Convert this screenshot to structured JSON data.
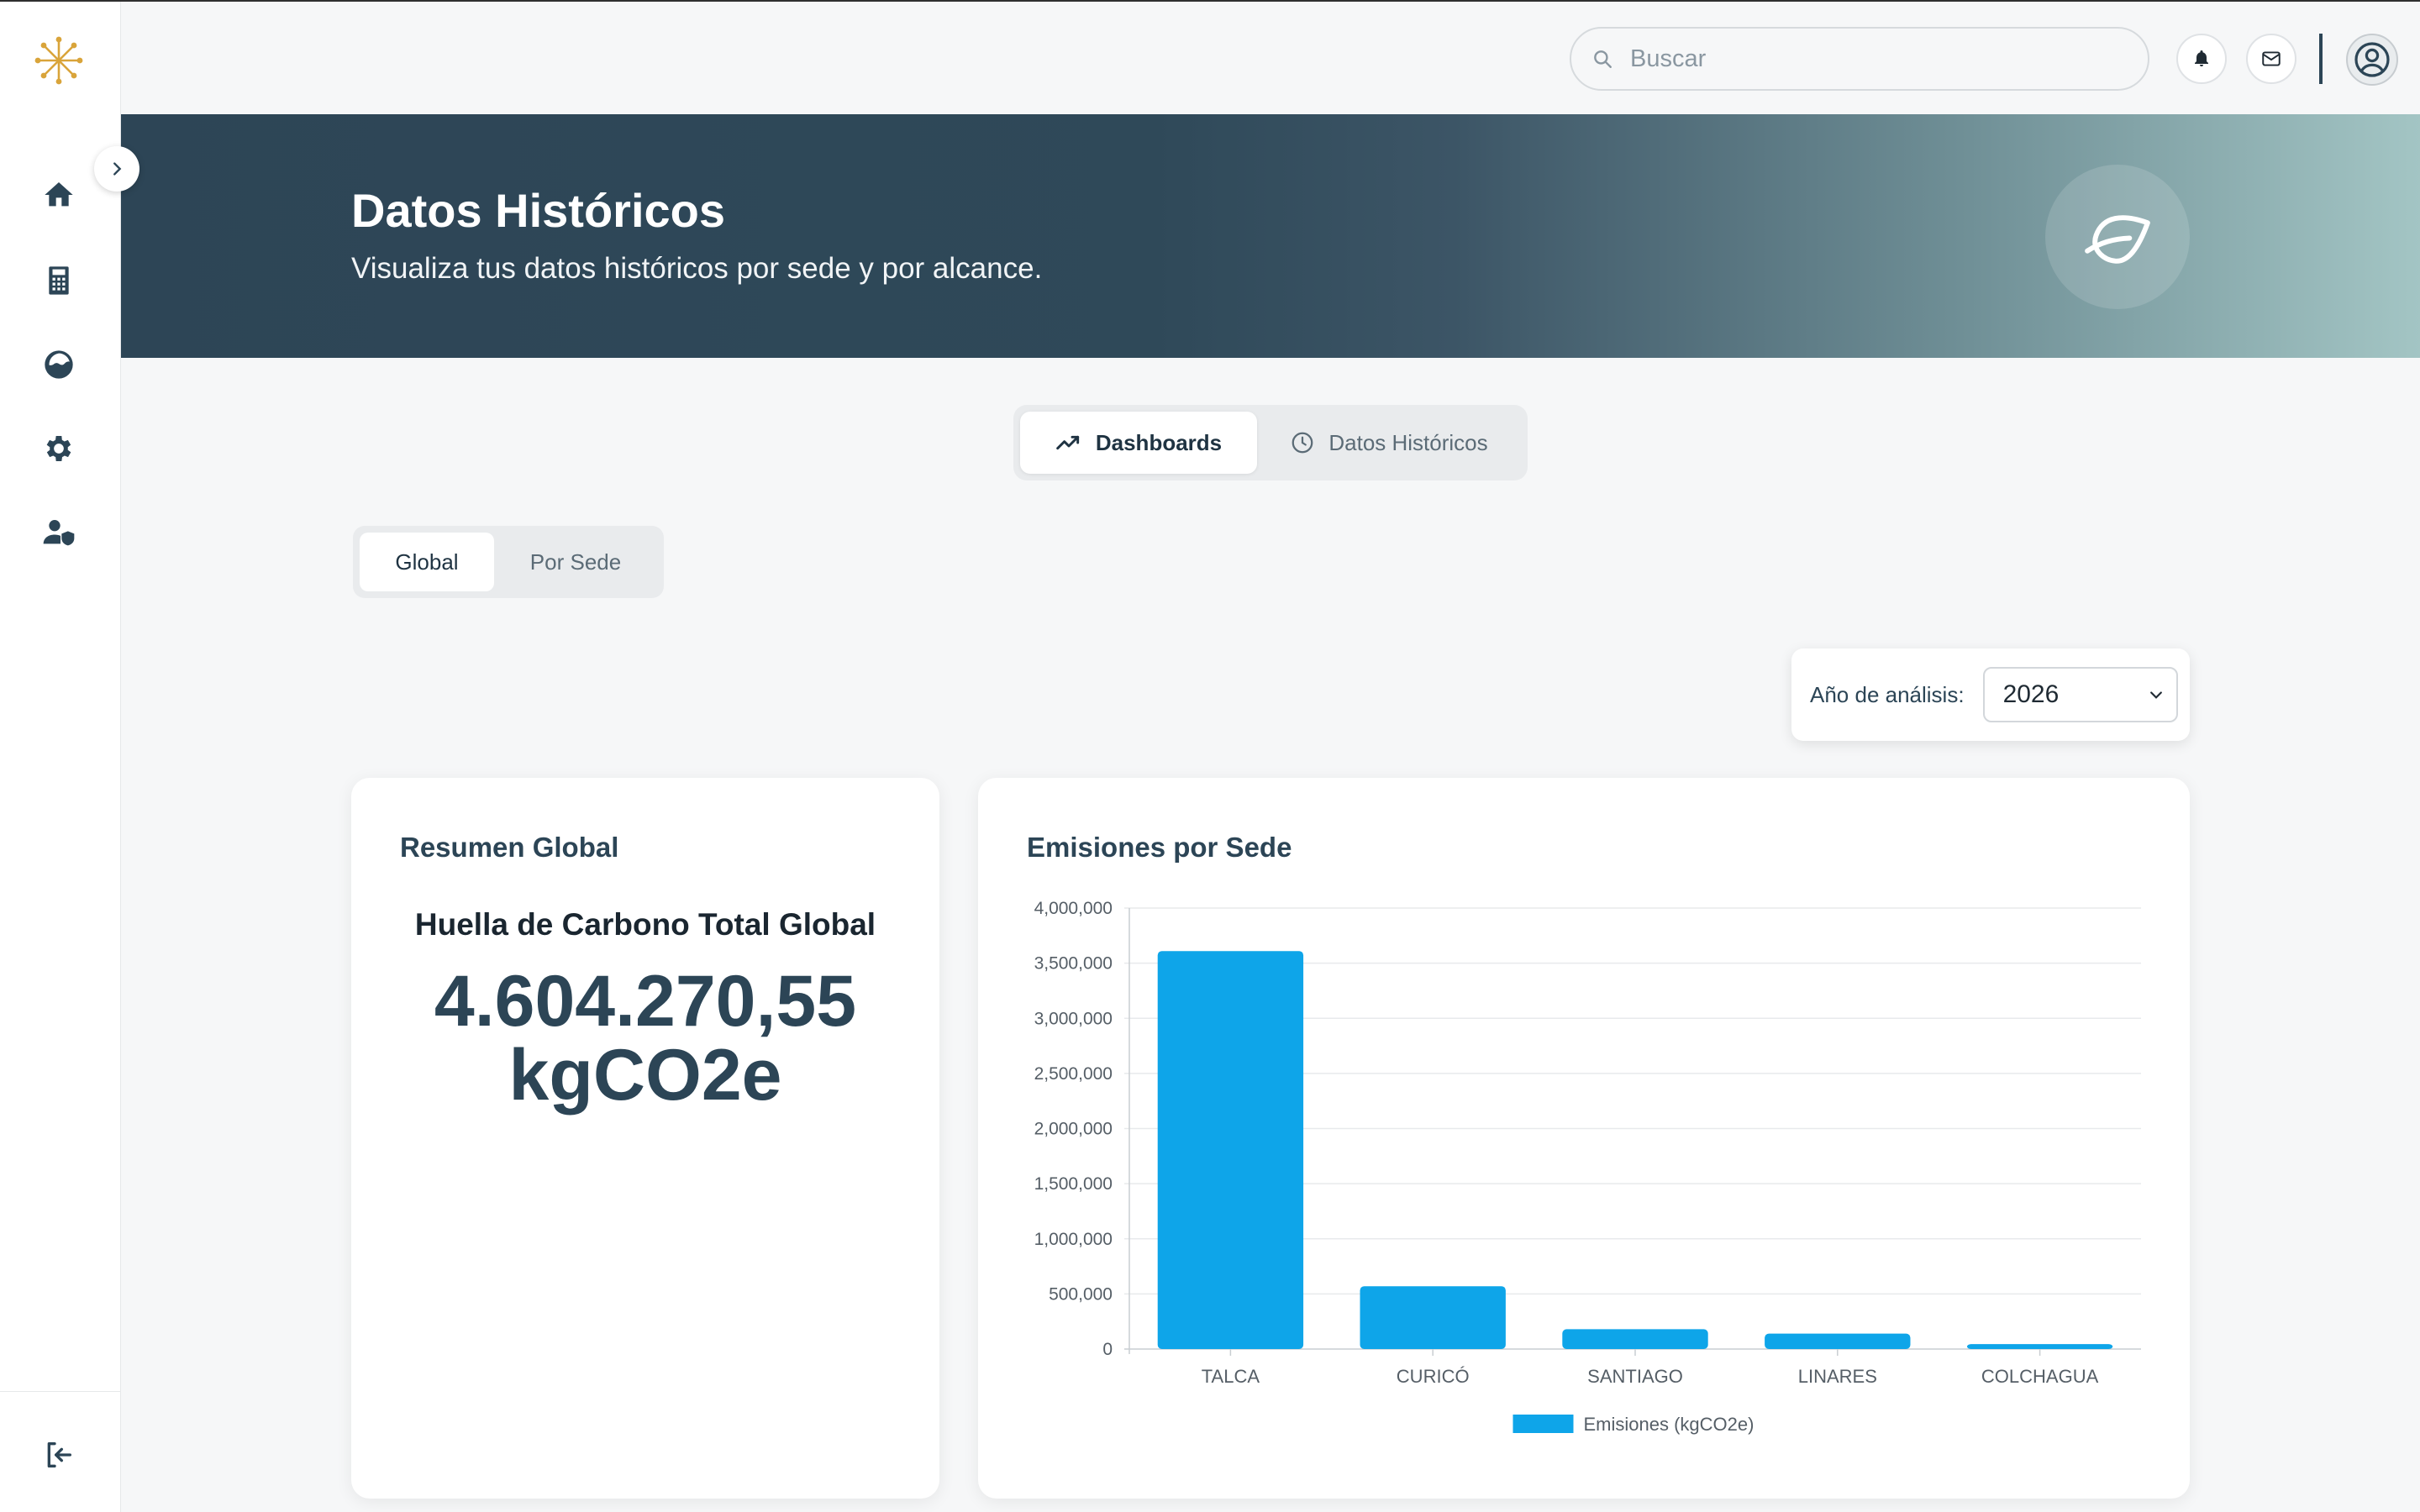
{
  "search": {
    "placeholder": "Buscar"
  },
  "banner": {
    "title": "Datos Históricos",
    "subtitle": "Visualiza tus datos históricos por sede y por alcance."
  },
  "main_tabs": [
    {
      "label": "Dashboards",
      "icon": "trend-line-icon",
      "active": true
    },
    {
      "label": "Datos Históricos",
      "icon": "clock-icon",
      "active": false
    }
  ],
  "sub_tabs": [
    {
      "label": "Global",
      "active": true
    },
    {
      "label": "Por Sede",
      "active": false
    }
  ],
  "year_filter": {
    "label": "Año de análisis:",
    "value": "2026"
  },
  "summary_card": {
    "title": "Resumen Global",
    "heading": "Huella de Carbono Total Global",
    "value": "4.604.270,55",
    "unit": "kgCO2e"
  },
  "chart_card": {
    "title": "Emisiones por Sede"
  },
  "chart_data": {
    "type": "bar",
    "categories": [
      "TALCA",
      "CURICÓ",
      "SANTIAGO",
      "LINARES",
      "COLCHAGUA"
    ],
    "series": [
      {
        "name": "Emisiones (kgCO2e)",
        "values": [
          3610000,
          570000,
          180000,
          140000,
          45000
        ],
        "color": "#0ea5e9"
      }
    ],
    "ylim": [
      0,
      4000000
    ],
    "yticks": [
      0,
      500000,
      1000000,
      1500000,
      2000000,
      2500000,
      3000000,
      3500000,
      4000000
    ],
    "ytick_labels": [
      "0",
      "500,000",
      "1,000,000",
      "1,500,000",
      "2,000,000",
      "2,500,000",
      "3,000,000",
      "3,500,000",
      "4,000,000"
    ],
    "grid": true,
    "legend": "bottom"
  },
  "colors": {
    "primary": "#2c4556",
    "bar": "#0ea5e9",
    "logo": "#d9a43a"
  },
  "sidebar": {
    "items": [
      {
        "icon": "home-icon"
      },
      {
        "icon": "calculator-icon"
      },
      {
        "icon": "earth-icon"
      },
      {
        "icon": "gear-icon"
      },
      {
        "icon": "user-shield-icon"
      }
    ],
    "footer_icon": "logout-icon"
  }
}
